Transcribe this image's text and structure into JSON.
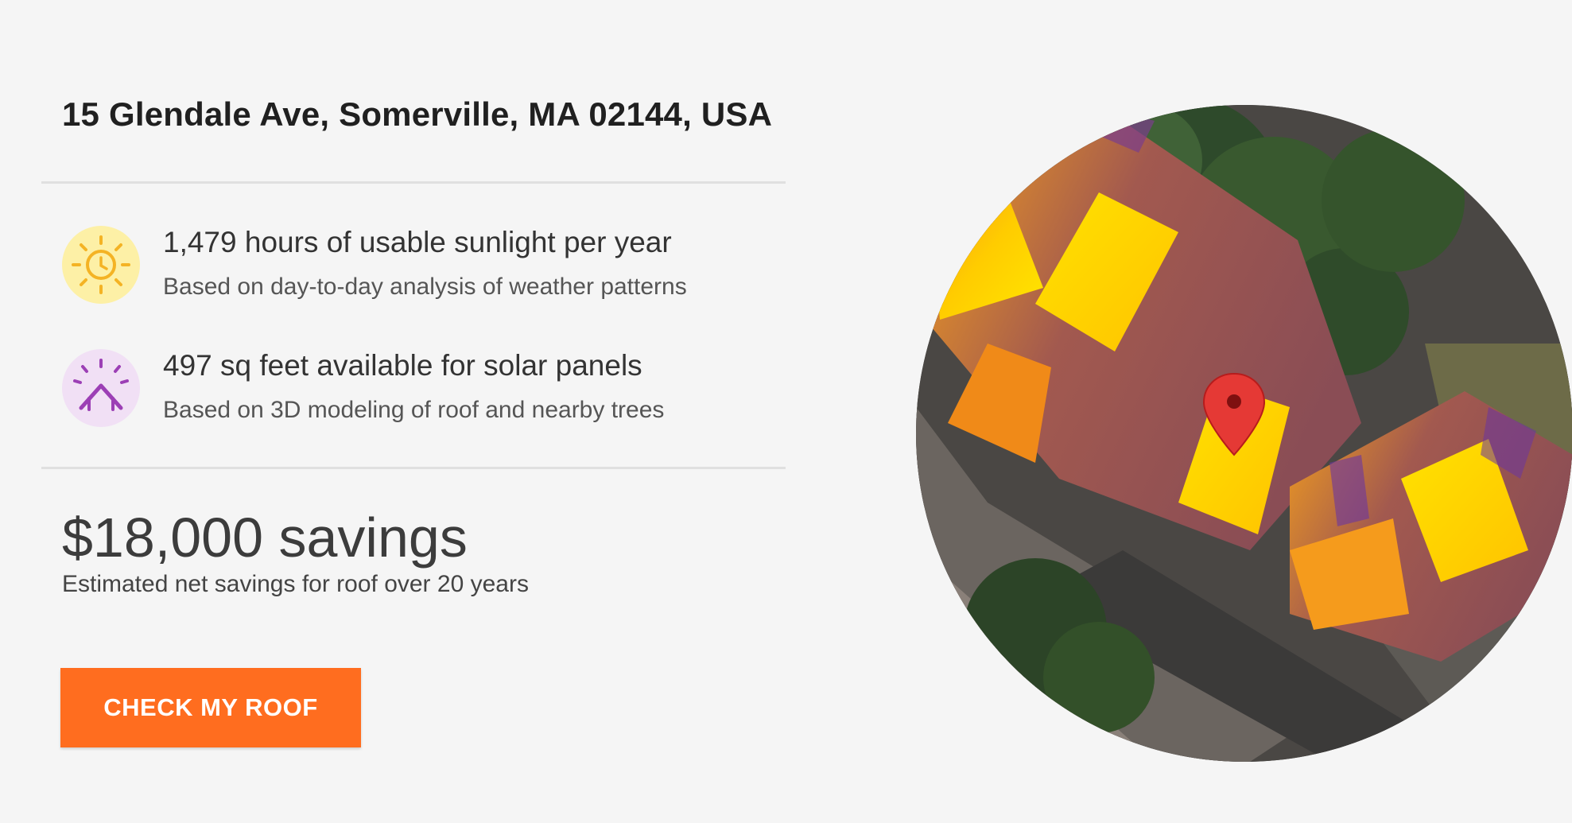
{
  "address": "15 Glendale Ave, Somerville, MA 02144, USA",
  "features": [
    {
      "icon": "sun-clock-icon",
      "title": "1,479 hours of usable sunlight per year",
      "subtitle": "Based on day-to-day analysis of weather patterns"
    },
    {
      "icon": "roof-sun-icon",
      "title": "497 sq feet available for solar panels",
      "subtitle": "Based on 3D modeling of roof and nearby trees"
    }
  ],
  "savings": {
    "title": "$18,000 savings",
    "subtitle": "Estimated net savings for roof over 20 years"
  },
  "cta": {
    "label": "CHECK MY ROOF"
  },
  "map": {
    "marker_icon": "location-pin-icon"
  },
  "colors": {
    "accent": "#ff6d1f",
    "background": "#f5f5f5",
    "sun_icon_bg": "#fdf0a6",
    "roof_icon_bg": "#f1e0f5",
    "marker": "#e53935"
  }
}
